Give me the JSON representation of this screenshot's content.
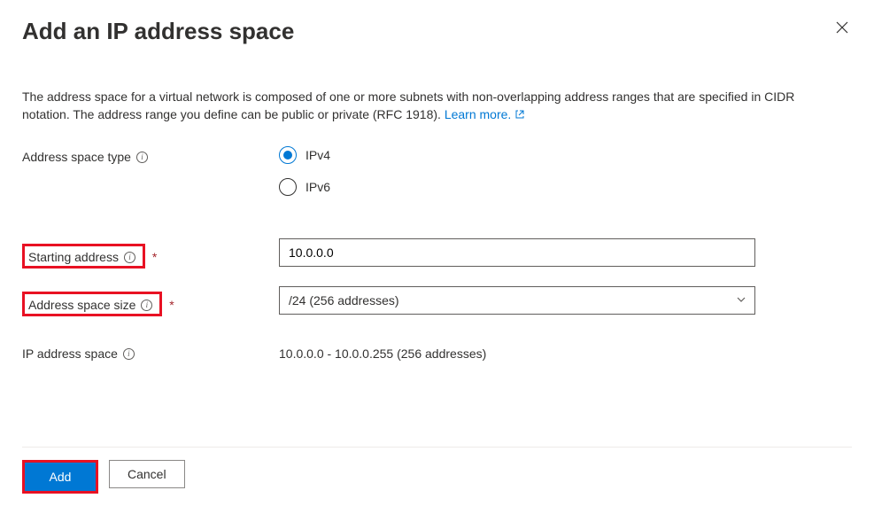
{
  "header": {
    "title": "Add an IP address space"
  },
  "description": {
    "text": "The address space for a virtual network is composed of one or more subnets with non-overlapping address ranges that are specified in CIDR notation. The address range you define can be public or private (RFC 1918). ",
    "learn_more": "Learn more."
  },
  "fields": {
    "type_label": "Address space type",
    "type_options": {
      "ipv4": "IPv4",
      "ipv6": "IPv6"
    },
    "starting_label": "Starting address",
    "starting_value": "10.0.0.0",
    "size_label": "Address space size",
    "size_value": "/24 (256 addresses)",
    "range_label": "IP address space",
    "range_value": "10.0.0.0 - 10.0.0.255 (256 addresses)"
  },
  "footer": {
    "add": "Add",
    "cancel": "Cancel"
  }
}
